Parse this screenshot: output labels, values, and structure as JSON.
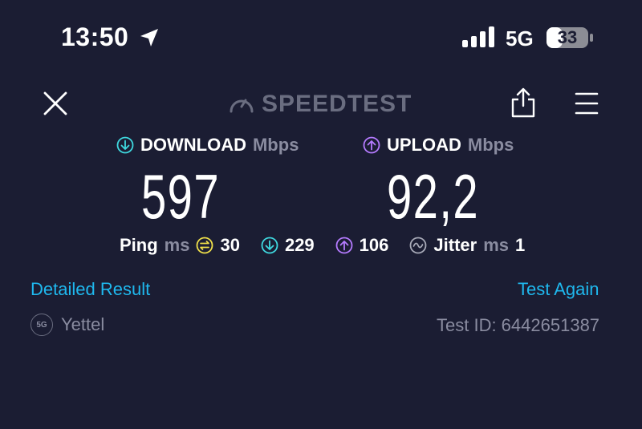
{
  "status_bar": {
    "time": "13:50",
    "network": "5G",
    "battery": "33"
  },
  "header": {
    "logo_text": "SPEEDTEST",
    "icons": [
      "close-icon",
      "speedometer-icon",
      "share-icon",
      "menu-icon"
    ]
  },
  "download": {
    "label": "DOWNLOAD",
    "unit": "Mbps",
    "value": "597"
  },
  "upload": {
    "label": "UPLOAD",
    "unit": "Mbps",
    "value": "92,2"
  },
  "ping": {
    "label": "Ping",
    "unit": "ms",
    "idle": "30",
    "download": "229",
    "upload": "106"
  },
  "jitter": {
    "label": "Jitter",
    "unit": "ms",
    "value": "1"
  },
  "actions": {
    "detailed_result": "Detailed Result",
    "test_again": "Test Again"
  },
  "provider": {
    "badge": "5G",
    "name": "Yettel"
  },
  "test_id": "Test ID: 6442651387",
  "colors": {
    "background": "#1b1d33",
    "download_accent": "#3fd9e0",
    "upload_accent": "#b57bff",
    "idle_ping": "#f0e04a",
    "link": "#1fb8ee",
    "muted": "#8a8ca0"
  }
}
